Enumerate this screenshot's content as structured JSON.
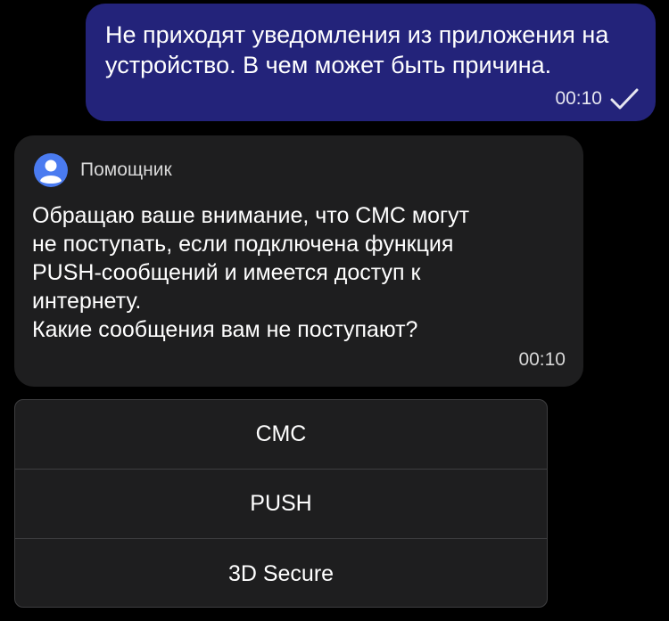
{
  "outgoing_message": {
    "text": "Не приходят уведомления из приложения на\nустройство. В чем может быть причина.",
    "time": "00:10",
    "status_icon": "checkmark-icon",
    "bubble_color": "#23237a"
  },
  "incoming_message": {
    "sender": "Помощник",
    "avatar_icon": "user-avatar-icon",
    "avatar_color": "#4a7bf0",
    "text": "Обращаю ваше внимание, что СМС могут\nне поступать, если подключена функция\nPUSH-сообщений и имеется доступ к\nинтернету.\nКакие сообщения вам не поступают?",
    "time": "00:10",
    "bubble_color": "#1e1e1f"
  },
  "quick_replies": [
    {
      "label": "СМС"
    },
    {
      "label": "PUSH"
    },
    {
      "label": "3D Secure"
    }
  ]
}
